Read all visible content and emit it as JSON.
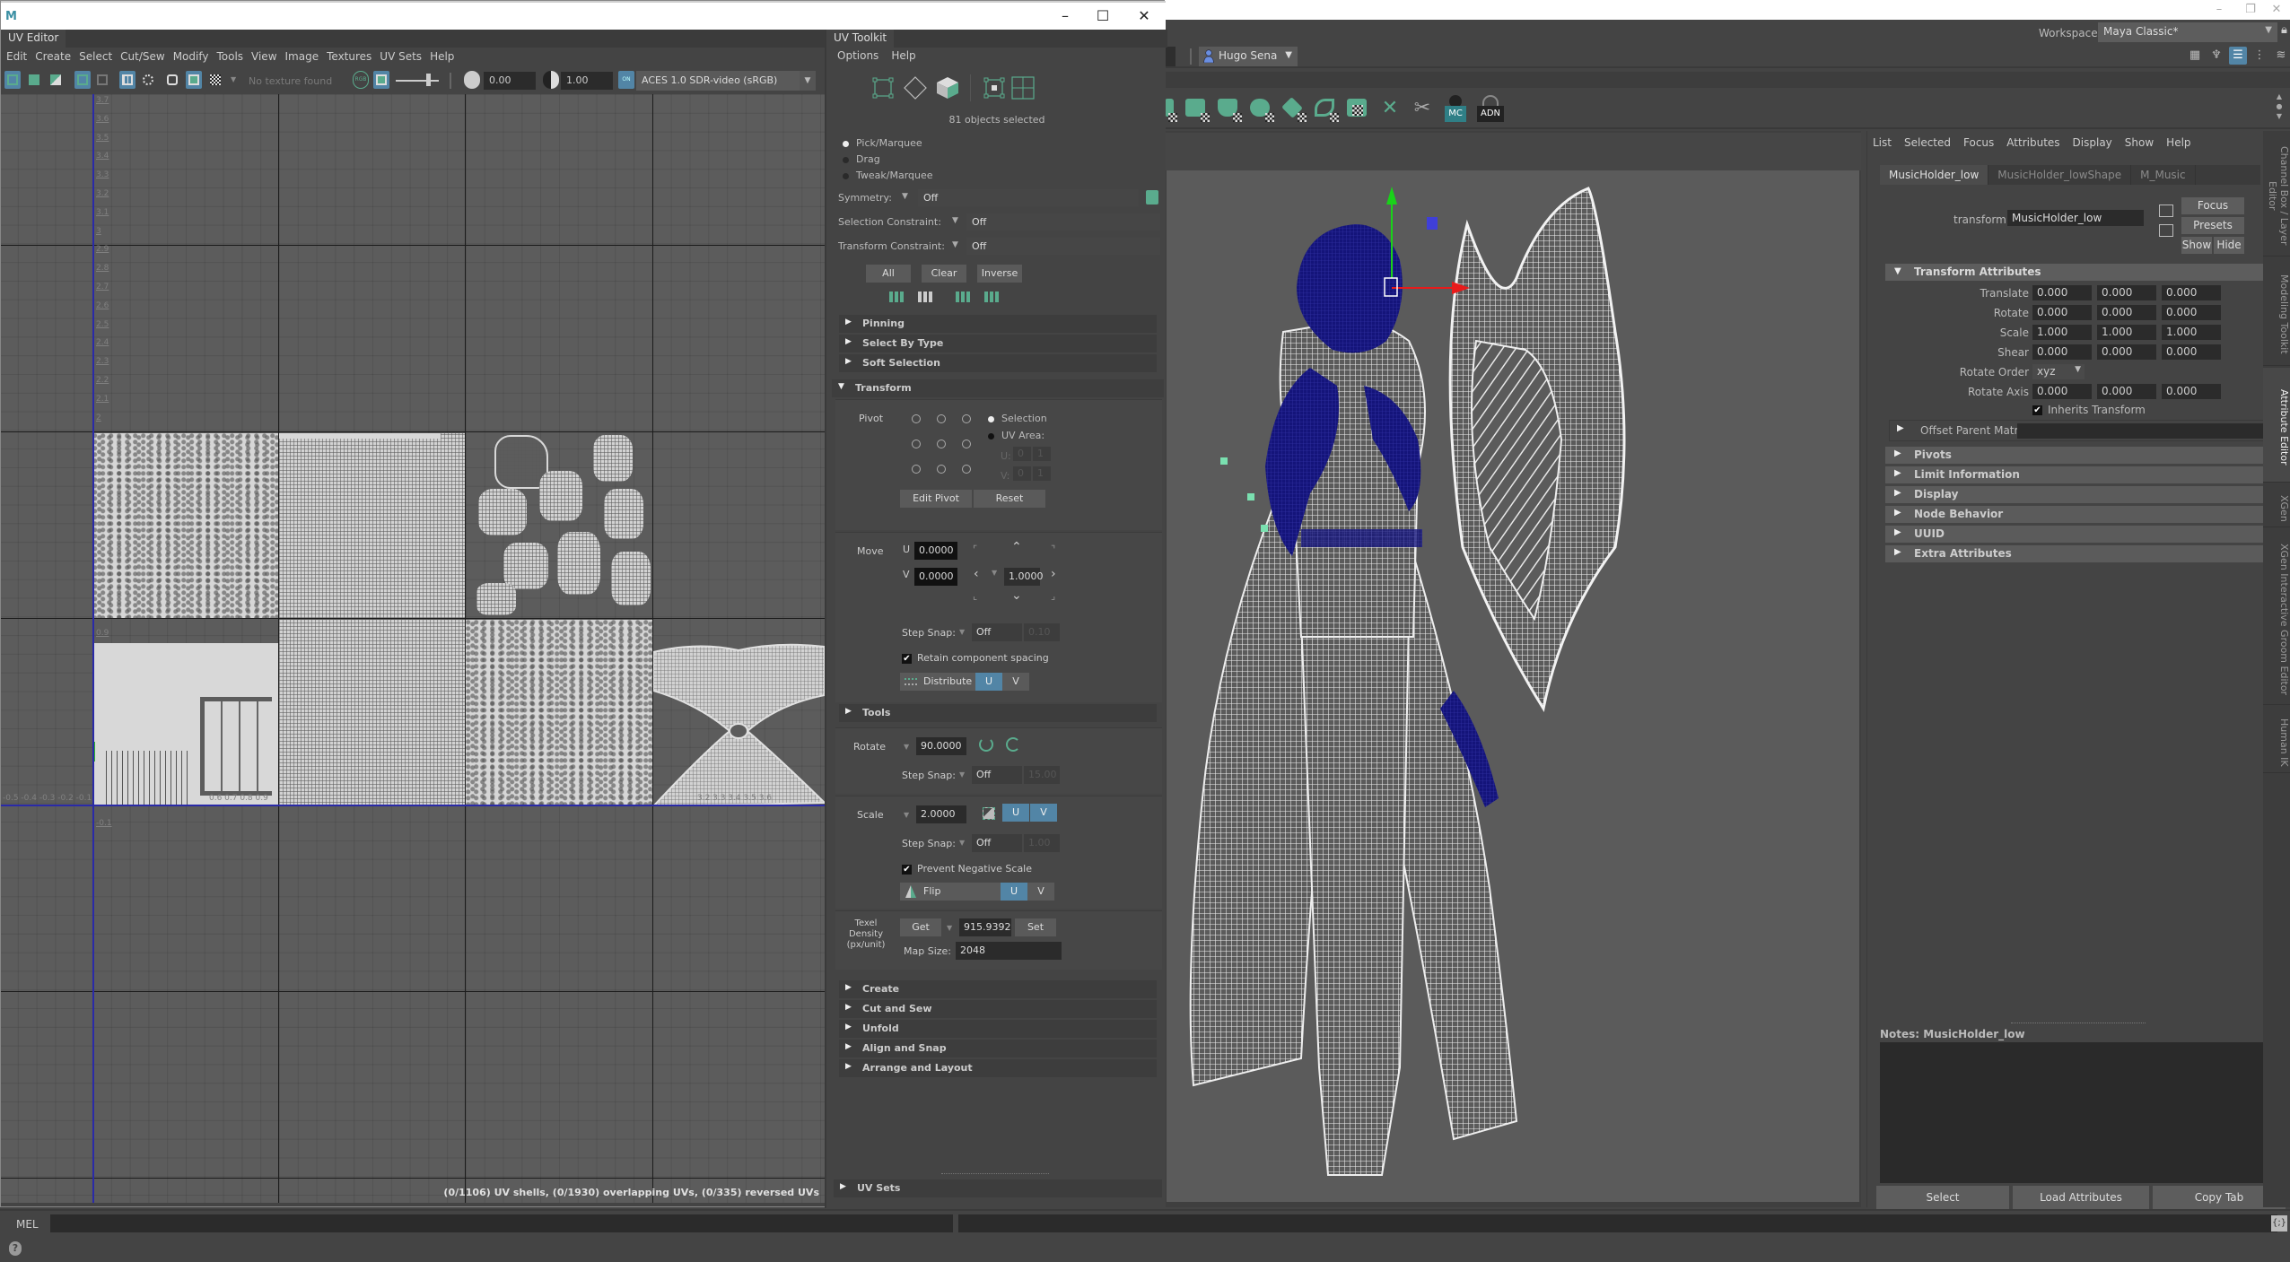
{
  "uv_editor": {
    "window_controls": {
      "minimize": "–",
      "maximize": "☐",
      "close": "✕"
    },
    "logo": "M",
    "tab_label": "UV Editor",
    "menu": [
      "Edit",
      "Create",
      "Select",
      "Cut/Sew",
      "Modify",
      "Tools",
      "View",
      "Image",
      "Textures",
      "UV Sets",
      "Help"
    ],
    "toolbar": {
      "texture_placeholder": "No texture found",
      "exposure": "0.00",
      "gamma": "1.00",
      "color_space": "ACES 1.0 SDR-video (sRGB)",
      "rgb_label": "RGB",
      "ocio_label": "ON"
    },
    "grid": {
      "v_ticks": [
        "3.7",
        "3.6",
        "3.5",
        "3.4",
        "3.3",
        "3.2",
        "3.1",
        "3",
        "2.9",
        "2.8",
        "2.7",
        "2.6",
        "2.5",
        "2.4",
        "2.3",
        "2.2",
        "2.1",
        "2",
        "0.9",
        "-0.1"
      ],
      "u_ticks_left": "-0.5 -0.4 -0.3 -0.2 -0.1",
      "u_ticks_mid": "0.6 0.7 0.8 0.9",
      "u_ticks_right": "3.2 3.3 3.4 3.5 3.6",
      "bottom_v_ticks": [
        "2",
        "2.1"
      ]
    },
    "status": "(0/1106) UV shells, (0/1930) overlapping UVs, (0/335) reversed UVs"
  },
  "uv_toolkit": {
    "tab_label": "UV Toolkit",
    "menu": [
      "Options",
      "Help"
    ],
    "selection_count": "81 objects selected",
    "tool_modes": [
      {
        "label": "Pick/Marquee",
        "selected": true
      },
      {
        "label": "Drag",
        "selected": false
      },
      {
        "label": "Tweak/Marquee",
        "selected": false
      }
    ],
    "symmetry": {
      "label": "Symmetry:",
      "value": "Off"
    },
    "selection_constraint": {
      "label": "Selection Constraint:",
      "value": "Off"
    },
    "transform_constraint": {
      "label": "Transform Constraint:",
      "value": "Off"
    },
    "select_buttons": [
      "All",
      "Clear",
      "Inverse"
    ],
    "collapsed_top": [
      "Pinning",
      "Select By Type",
      "Soft Selection"
    ],
    "transform": {
      "title": "Transform",
      "pivot_label": "Pivot",
      "pivot_modes": [
        {
          "label": "Selection",
          "selected": true
        },
        {
          "label": "UV Area:",
          "selected": false
        }
      ],
      "uv_area": {
        "u_label": "U:",
        "u_min": "0",
        "u_max": "1",
        "v_label": "V:",
        "v_min": "0",
        "v_max": "1"
      },
      "edit_pivot": "Edit Pivot",
      "reset": "Reset",
      "move": {
        "label": "Move",
        "u_label": "U",
        "u_value": "0.0000",
        "v_label": "V",
        "v_value": "0.0000",
        "step": "1.0000",
        "step_snap_label": "Step Snap:",
        "step_snap_value": "Off",
        "step_snap_amount": "0.10",
        "retain_spacing_label": "Retain component spacing",
        "retain_spacing_checked": true,
        "distribute_label": "Distribute",
        "u": "U",
        "v": "V"
      },
      "tools_section": "Tools",
      "rotate": {
        "label": "Rotate",
        "value": "90.0000",
        "step_snap_label": "Step Snap:",
        "step_snap_value": "Off",
        "step_snap_amount": "15.00"
      },
      "scale": {
        "label": "Scale",
        "value": "2.0000",
        "u": "U",
        "v": "V",
        "step_snap_label": "Step Snap:",
        "step_snap_value": "Off",
        "step_snap_amount": "1.00",
        "prevent_negative_label": "Prevent Negative Scale",
        "prevent_negative_checked": true,
        "flip_label": "Flip",
        "flip_u": "U",
        "flip_v": "V"
      },
      "texel_density": {
        "label": "Texel Density (px/unit)",
        "get": "Get",
        "value": "915.9392",
        "set": "Set",
        "map_size_label": "Map Size:",
        "map_size": "2048"
      }
    },
    "collapsed_bottom": [
      "Create",
      "Cut and Sew",
      "Unfold",
      "Align and Snap",
      "Arrange and Layout"
    ],
    "uv_sets": "UV Sets"
  },
  "maya": {
    "window_controls": {
      "minimize": "–",
      "restore": "❐",
      "close": "✕"
    },
    "workspace_label": "Workspace:",
    "workspace_value": "Maya Classic*",
    "user": "Hugo Sena",
    "shelf_labels": [
      "MC",
      "ADN"
    ]
  },
  "attribute_editor": {
    "menu": [
      "List",
      "Selected",
      "Focus",
      "Attributes",
      "Display",
      "Show",
      "Help"
    ],
    "tabs": [
      {
        "label": "MusicHolder_low",
        "active": true
      },
      {
        "label": "MusicHolder_lowShape",
        "active": false
      },
      {
        "label": "M_Music",
        "active": false
      }
    ],
    "node_type_label": "transform:",
    "node_name": "MusicHolder_low",
    "buttons": {
      "focus": "Focus",
      "presets": "Presets",
      "show": "Show",
      "hide": "Hide"
    },
    "transform_attributes": {
      "title": "Transform Attributes",
      "rows": [
        {
          "label": "Translate",
          "values": [
            "0.000",
            "0.000",
            "0.000"
          ]
        },
        {
          "label": "Rotate",
          "values": [
            "0.000",
            "0.000",
            "0.000"
          ]
        },
        {
          "label": "Scale",
          "values": [
            "1.000",
            "1.000",
            "1.000"
          ]
        },
        {
          "label": "Shear",
          "values": [
            "0.000",
            "0.000",
            "0.000"
          ]
        }
      ],
      "rotate_order_label": "Rotate Order",
      "rotate_order_value": "xyz",
      "rotate_axis": {
        "label": "Rotate Axis",
        "values": [
          "0.000",
          "0.000",
          "0.000"
        ]
      },
      "inherits_transform_label": "Inherits Transform",
      "inherits_transform_checked": true
    },
    "offset_parent_matrix": "Offset Parent Matrix",
    "sections": [
      "Pivots",
      "Limit Information",
      "Display",
      "Node Behavior",
      "UUID",
      "Extra Attributes"
    ],
    "notes_label": "Notes:  MusicHolder_low",
    "bottom_buttons": [
      "Select",
      "Load Attributes",
      "Copy Tab"
    ]
  },
  "side_tabs": [
    {
      "label": "Channel Box / Layer Editor",
      "active": false
    },
    {
      "label": "Modeling Toolkit",
      "active": false
    },
    {
      "label": "Attribute Editor",
      "active": true
    },
    {
      "label": "XGen",
      "active": false
    },
    {
      "label": "XGen Interactive Groom Editor",
      "active": false
    },
    {
      "label": "Human IK",
      "active": false
    }
  ],
  "command_line": {
    "label": "MEL"
  },
  "colors": {
    "accent_blue": "#5285a6",
    "shelf_green": "#5aab8d",
    "selection_navy": "#14147a",
    "uv_axis": "#2a2aa8"
  }
}
